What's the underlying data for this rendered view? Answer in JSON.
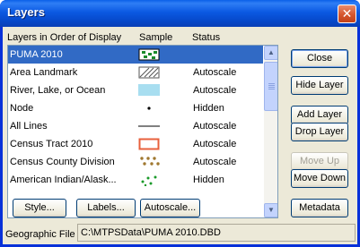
{
  "window": {
    "title": "Layers",
    "close_glyph": "✕"
  },
  "columns": {
    "layers": "Layers in Order of Display",
    "sample": "Sample",
    "status": "Status"
  },
  "layers": [
    {
      "name": "PUMA 2010",
      "sample": "puma-icon",
      "status": "",
      "selected": true
    },
    {
      "name": "Area Landmark",
      "sample": "hatch-icon",
      "status": "Autoscale"
    },
    {
      "name": "River, Lake, or Ocean",
      "sample": "water-fill-icon",
      "status": "Autoscale"
    },
    {
      "name": "Node",
      "sample": "dot-icon",
      "status": "Hidden"
    },
    {
      "name": "All Lines",
      "sample": "line-icon",
      "status": "Autoscale"
    },
    {
      "name": "Census Tract 2010",
      "sample": "outline-box-icon",
      "status": "Autoscale"
    },
    {
      "name": "Census County Division",
      "sample": "dots-brown-icon",
      "status": "Autoscale"
    },
    {
      "name": "American Indian/Alask...",
      "sample": "dots-green-icon",
      "status": "Hidden"
    }
  ],
  "buttons": {
    "close": "Close",
    "hide_layer": "Hide Layer",
    "add_layer": "Add Layer",
    "drop_layer": "Drop Layer",
    "move_up": "Move Up",
    "move_down": "Move Down",
    "metadata": "Metadata",
    "style": "Style...",
    "labels": "Labels...",
    "autoscale": "Autoscale..."
  },
  "geographic_file": {
    "label": "Geographic File",
    "value": "C:\\MTPSData\\PUMA 2010.DBD"
  },
  "colors": {
    "selection": "#316ac5",
    "title_bar": "#0b59e2",
    "face": "#ece9d8",
    "water": "#a8def0",
    "outline_red": "#e8603c"
  }
}
